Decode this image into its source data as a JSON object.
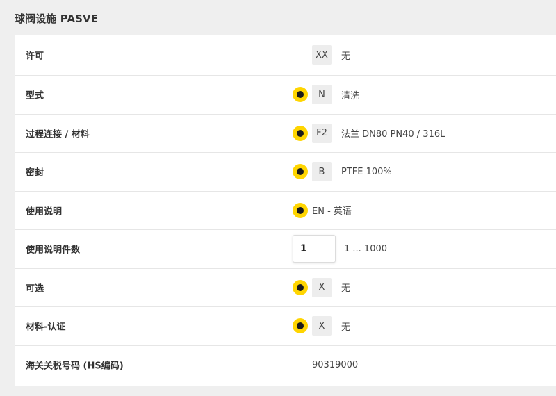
{
  "section": {
    "title": "球阀设施 PASVE"
  },
  "rows": [
    {
      "label": "许可",
      "code": "XX",
      "desc": "无",
      "selected": false
    },
    {
      "label": "型式",
      "code": "N",
      "desc": "清洗",
      "selected": true
    },
    {
      "label": "过程连接 / 材料",
      "code": "F2",
      "desc": "法兰 DN80 PN40 / 316L",
      "selected": true
    },
    {
      "label": "密封",
      "code": "B",
      "desc": "PTFE 100%",
      "selected": true
    },
    {
      "label": "使用说明",
      "desc": "EN - 英语",
      "selected": true
    },
    {
      "label": "使用说明件数",
      "qty_value": "1",
      "qty_range": "1 ... 1000"
    },
    {
      "label": "可选",
      "code": "X",
      "desc": "无",
      "selected": true
    },
    {
      "label": "材料-认证",
      "code": "X",
      "desc": "无",
      "selected": true
    },
    {
      "label": "海关关税号码 (HS编码)",
      "value": "90319000"
    }
  ],
  "colors": {
    "radio_selected": "#ffd500",
    "code_box_bg": "#ededed",
    "panel_bg": "#ffffff",
    "page_bg": "#efefef"
  }
}
